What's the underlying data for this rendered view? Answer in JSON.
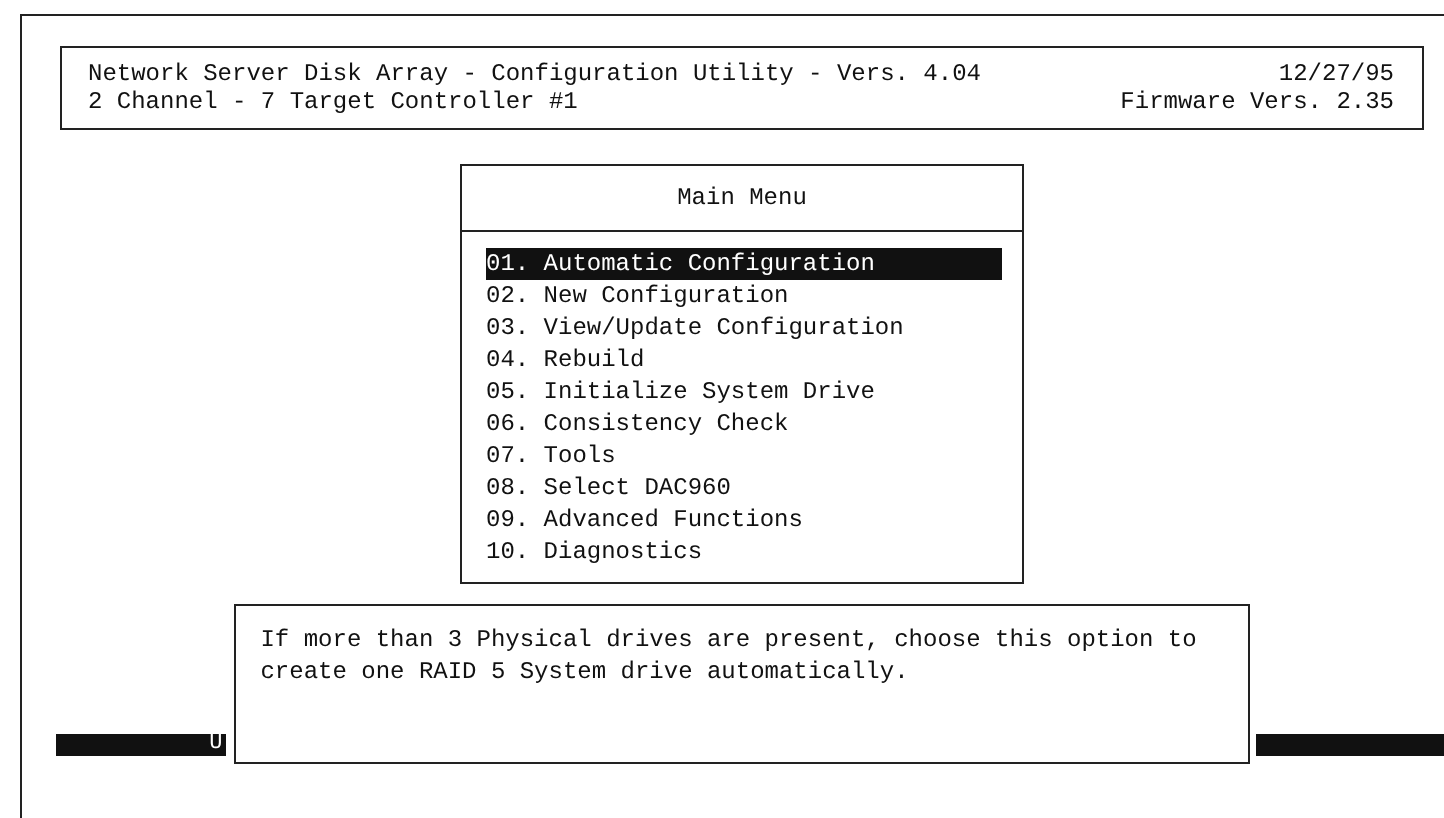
{
  "header": {
    "title": "Network Server Disk Array - Configuration Utility - Vers. 4.04",
    "date": "12/27/95",
    "controller": "2 Channel - 7 Target Controller #1",
    "firmware": "Firmware Vers. 2.35"
  },
  "menu": {
    "title": "Main Menu",
    "items": [
      {
        "label": "01. Automatic Configuration",
        "selected": true
      },
      {
        "label": "02. New Configuration",
        "selected": false
      },
      {
        "label": "03. View/Update Configuration",
        "selected": false
      },
      {
        "label": "04. Rebuild",
        "selected": false
      },
      {
        "label": "05. Initialize System Drive",
        "selected": false
      },
      {
        "label": "06. Consistency Check",
        "selected": false
      },
      {
        "label": "07. Tools",
        "selected": false
      },
      {
        "label": "08. Select DAC960",
        "selected": false
      },
      {
        "label": "09. Advanced Functions",
        "selected": false
      },
      {
        "label": "10. Diagnostics",
        "selected": false
      }
    ]
  },
  "help": {
    "text": "If more than 3 Physical drives are present, choose this option to create one RAID 5 System drive automatically."
  },
  "status_bar": {
    "text": "U"
  }
}
